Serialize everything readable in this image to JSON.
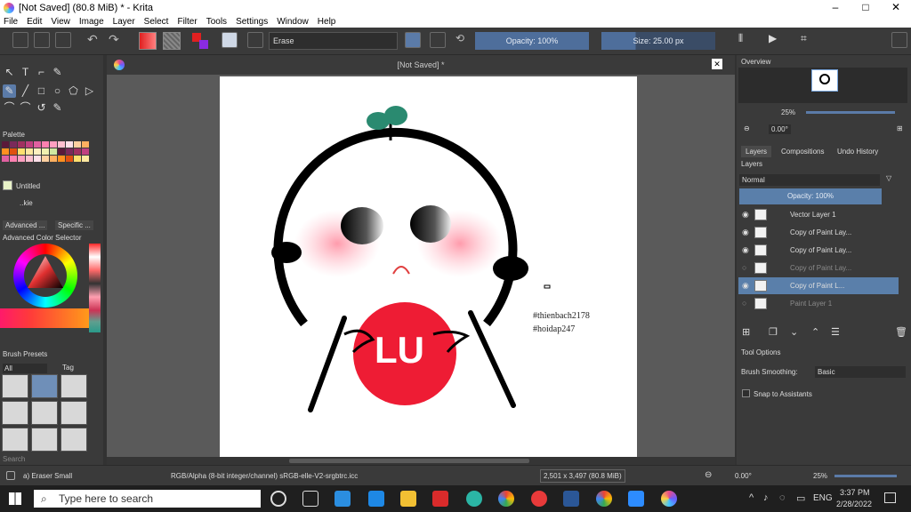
{
  "window": {
    "title": "[Not Saved]  (80.8 MiB)  * - Krita",
    "minimize": "–",
    "maximize": "□",
    "close": "✕"
  },
  "menu": [
    "File",
    "Edit",
    "View",
    "Image",
    "Layer",
    "Select",
    "Filter",
    "Tools",
    "Settings",
    "Window",
    "Help"
  ],
  "toolbar": {
    "blend_mode": "Erase",
    "opacity": "Opacity: 100%",
    "size": "Size: 25.00 px",
    "fg_color": "#e02020",
    "bg_color": "#8a2be2"
  },
  "left": {
    "palette_title": "Palette",
    "palette_name": "Untitled",
    "palette_combo": "..kie",
    "tabs": [
      "Advanced ...",
      "Specific ..."
    ],
    "color_selector_title": "Advanced Color Selector",
    "brush_presets_title": "Brush Presets",
    "brush_filter": "All",
    "brush_tag": "Tag",
    "search_placeholder": "Search"
  },
  "canvas": {
    "doc_title": "[Not Saved]  *",
    "signature_1": "#thienbach2178",
    "signature_2": "#hoidap247",
    "shirt_text": "LU"
  },
  "right": {
    "overview_title": "Overview",
    "zoom": "25%",
    "rotation": "0.00°",
    "tabs": [
      "Layers",
      "Compositions",
      "Undo History"
    ],
    "layers_title": "Layers",
    "blend": "Normal",
    "layer_opacity": "Opacity:  100%",
    "layers": [
      {
        "name": "Vector Layer 1",
        "selected": false,
        "dim": false,
        "eye": "◉"
      },
      {
        "name": "Copy of Paint Lay...",
        "selected": false,
        "dim": false,
        "eye": "◉"
      },
      {
        "name": "Copy of Paint Lay...",
        "selected": false,
        "dim": false,
        "eye": "◉"
      },
      {
        "name": "Copy of Paint Lay...",
        "selected": false,
        "dim": true,
        "eye": "○"
      },
      {
        "name": "Copy of Paint L...",
        "selected": true,
        "dim": false,
        "eye": "◉"
      },
      {
        "name": "Paint Layer 1",
        "selected": false,
        "dim": true,
        "eye": "○"
      }
    ],
    "tool_options_title": "Tool Options",
    "brush_smoothing_label": "Brush Smoothing:",
    "brush_smoothing_value": "Basic",
    "snap_label": "Snap to Assistants"
  },
  "status": {
    "brush": "a) Eraser Small",
    "colorspace": "RGB/Alpha (8-bit integer/channel)  sRGB-elle-V2-srgbtrc.icc",
    "dimensions": "2,501 x 3,497 (80.8 MiB)",
    "rotation": "0.00°",
    "zoom": "25%"
  },
  "taskbar": {
    "search": "Type here to search",
    "time": "3:37 PM",
    "date": "2/28/2022",
    "lang": "ENG"
  }
}
